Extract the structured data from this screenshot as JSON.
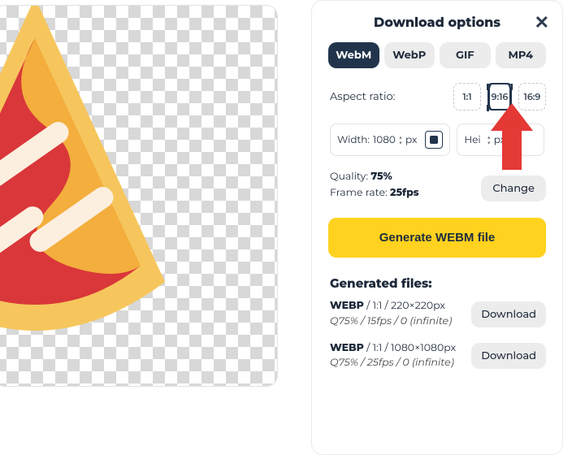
{
  "panel": {
    "title": "Download options",
    "close_glyph": "✕",
    "formats": [
      {
        "label": "WebM",
        "active": true
      },
      {
        "label": "WebP",
        "active": false
      },
      {
        "label": "GIF",
        "active": false
      },
      {
        "label": "MP4",
        "active": false
      }
    ],
    "aspect_label": "Aspect ratio:",
    "ratios": [
      {
        "label": "1:1",
        "selected": false
      },
      {
        "label": "9:16",
        "selected": true
      },
      {
        "label": "16:9",
        "selected": false
      }
    ],
    "width_label": "Width:",
    "width_value": "1080",
    "height_label": "Hei",
    "height_value": "",
    "px": "px",
    "quality_label": "Quality:",
    "quality_value": "75%",
    "framerate_label": "Frame rate:",
    "framerate_value": "25fps",
    "change_label": "Change",
    "generate_label": "Generate WEBM file",
    "generated_heading": "Generated files:",
    "files": [
      {
        "fmt": "WEBP",
        "ratio": "1:1",
        "dims": "220×220px",
        "detail": "Q75% / 15fps / 0 (infinite)",
        "dl": "Download"
      },
      {
        "fmt": "WEBP",
        "ratio": "1:1",
        "dims": "1080×1080px",
        "detail": "Q75% / 25fps / 0 (infinite)",
        "dl": "Download"
      }
    ]
  },
  "annotation": {
    "arrow_color": "#e53935"
  }
}
